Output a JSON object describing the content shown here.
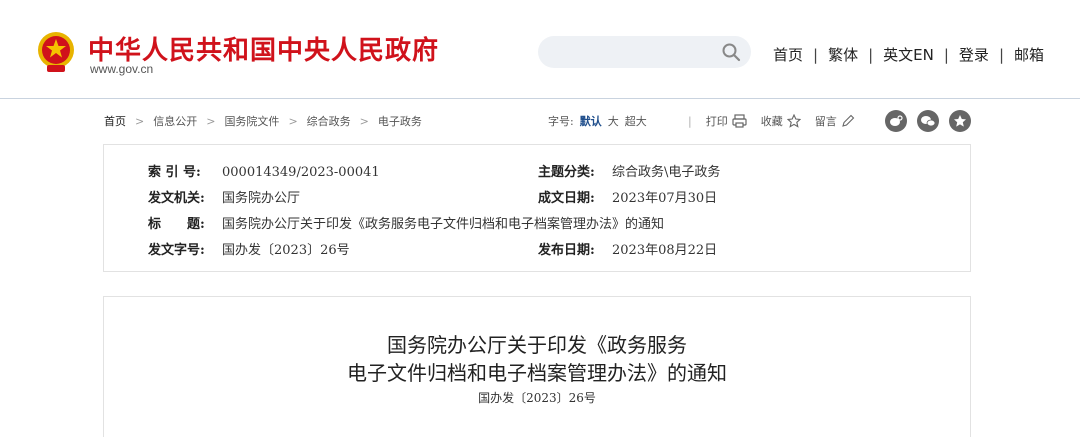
{
  "site": {
    "title": "中华人民共和国中央人民政府",
    "url": "www.gov.cn"
  },
  "search": {
    "placeholder": ""
  },
  "topnav": [
    "首页",
    "繁体",
    "英文EN",
    "登录",
    "邮箱"
  ],
  "breadcrumb": [
    "首页",
    "信息公开",
    "国务院文件",
    "综合政务",
    "电子政务"
  ],
  "fontsize": {
    "label": "字号:",
    "options": [
      "默认",
      "大",
      "超大"
    ]
  },
  "tools": {
    "print": "打印",
    "favorite": "收藏",
    "comment": "留言"
  },
  "meta": {
    "index_label": "索 引 号:",
    "index_value": "000014349/2023-00041",
    "category_label": "主题分类:",
    "category_value": "综合政务\\电子政务",
    "issuer_label": "发文机关:",
    "issuer_value": "国务院办公厅",
    "created_label": "成文日期:",
    "created_value": "2023年07月30日",
    "title_label": "标　　题:",
    "title_value": "国务院办公厅关于印发《政务服务电子文件归档和电子档案管理办法》的通知",
    "docno_label": "发文字号:",
    "docno_value": "国办发〔2023〕26号",
    "published_label": "发布日期:",
    "published_value": "2023年08月22日"
  },
  "document": {
    "title_line1": "国务院办公厅关于印发《政务服务",
    "title_line2": "电子文件归档和电子档案管理办法》的通知",
    "doc_no": "国办发〔2023〕26号"
  },
  "colors": {
    "brand_red": "#d0121b",
    "nav_blue": "#1f4e8c"
  }
}
